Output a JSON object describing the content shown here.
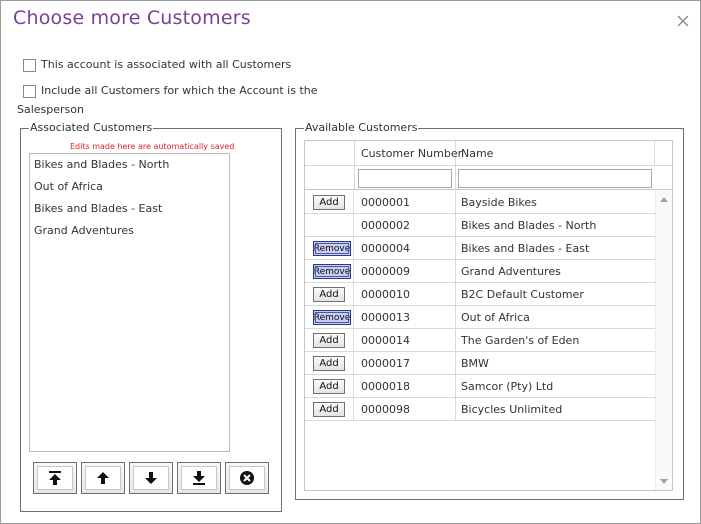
{
  "dialog": {
    "title": "Choose more Customers",
    "close_icon": "close-icon"
  },
  "options": {
    "all_customers_label": "This account is associated with all Customers",
    "salesperson_label_line1": "Include all Customers for which the Account is the",
    "salesperson_label_line2": "Salesperson"
  },
  "associated": {
    "legend": "Associated Customers",
    "note": "Edits made here are automatically saved",
    "items": [
      "Bikes and Blades - North",
      "Out of Africa",
      "Bikes and Blades - East",
      "Grand Adventures"
    ],
    "buttons": [
      "move-top-icon",
      "move-up-icon",
      "move-down-icon",
      "move-bottom-icon",
      "remove-circle-icon"
    ]
  },
  "available": {
    "legend": "Available Customers",
    "columns": {
      "number": "Customer Number",
      "name": "Name"
    },
    "filters": {
      "number": "",
      "name": ""
    },
    "rows": [
      {
        "action": "Add",
        "number": "0000001",
        "name": "Bayside Bikes"
      },
      {
        "action": "",
        "number": "0000002",
        "name": "Bikes and Blades - North"
      },
      {
        "action": "Remove",
        "number": "0000004",
        "name": "Bikes and Blades - East"
      },
      {
        "action": "Remove",
        "number": "0000009",
        "name": "Grand Adventures"
      },
      {
        "action": "Add",
        "number": "0000010",
        "name": "B2C Default Customer"
      },
      {
        "action": "Remove",
        "number": "0000013",
        "name": "Out of Africa"
      },
      {
        "action": "Add",
        "number": "0000014",
        "name": "The Garden's of Eden"
      },
      {
        "action": "Add",
        "number": "0000017",
        "name": "BMW"
      },
      {
        "action": "Add",
        "number": "0000018",
        "name": "Samcor (Pty) Ltd"
      },
      {
        "action": "Add",
        "number": "0000098",
        "name": "Bicycles Unlimited"
      }
    ]
  }
}
